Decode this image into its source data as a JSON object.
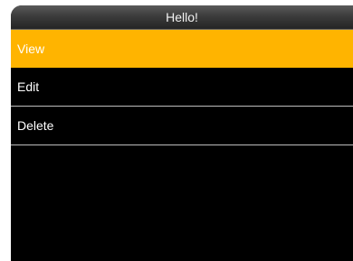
{
  "header": {
    "title": "Hello!"
  },
  "menu": {
    "items": [
      {
        "label": "View",
        "selected": true
      },
      {
        "label": "Edit",
        "selected": false
      },
      {
        "label": "Delete",
        "selected": false
      }
    ]
  },
  "colors": {
    "background": "#000000",
    "selected_highlight": "#ffb400",
    "text": "#ffffff",
    "divider": "#bdbdbd"
  }
}
